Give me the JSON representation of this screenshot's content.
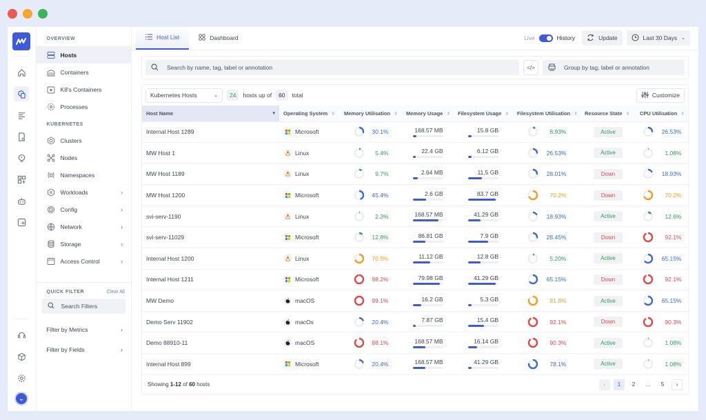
{
  "sidebar": {
    "overview_title": "OVERVIEW",
    "overview_items": [
      {
        "label": "Hosts",
        "icon": "server-icon",
        "active": true
      },
      {
        "label": "Containers",
        "icon": "container-icon"
      },
      {
        "label": "K8's Containers",
        "icon": "k8s-container-icon"
      },
      {
        "label": "Processes",
        "icon": "process-icon"
      }
    ],
    "kubernetes_title": "KUBERNETES",
    "kubernetes_items": [
      {
        "label": "Clusters",
        "icon": "cluster-icon",
        "chevron": false
      },
      {
        "label": "Nodes",
        "icon": "nodes-icon",
        "chevron": false
      },
      {
        "label": "Namespaces",
        "icon": "namespace-icon",
        "chevron": false
      },
      {
        "label": "Workloads",
        "icon": "workloads-icon",
        "chevron": true
      },
      {
        "label": "Config",
        "icon": "config-icon",
        "chevron": true
      },
      {
        "label": "Network",
        "icon": "globe-icon",
        "chevron": true
      },
      {
        "label": "Storage",
        "icon": "database-icon",
        "chevron": true
      },
      {
        "label": "Access Control",
        "icon": "window-icon",
        "chevron": true
      }
    ],
    "quick_filter_title": "QUICK FILTER",
    "clear_all": "Clear All",
    "search_filters_placeholder": "Search Filters",
    "filters": [
      {
        "label": "Filter by Metrics"
      },
      {
        "label": "Filter by Fields"
      }
    ]
  },
  "rail": {
    "icons": [
      "home-icon",
      "infrastructure-icon",
      "logs-icon",
      "report-icon",
      "alert-icon",
      "add-widget-icon",
      "bot-icon",
      "user-report-icon"
    ],
    "bottom_icons": [
      "support-icon",
      "integration-icon",
      "settings-icon"
    ]
  },
  "topbar": {
    "tabs": [
      {
        "label": "Host List",
        "active": true
      },
      {
        "label": "Dashboard",
        "active": false
      }
    ],
    "live_label": "Live",
    "history_label": "History",
    "update_label": "Update",
    "time_range": "Last 30 Days"
  },
  "search": {
    "placeholder": "Search by name, tag, label or annotation",
    "group_placeholder": "Group by tag, label or annotation"
  },
  "toolbar": {
    "host_type": "Kubernetes Hosts",
    "shown_count": "24",
    "count_text_mid": "hosts up of",
    "total_count": "60",
    "count_text_end": "total",
    "customize_label": "Customize"
  },
  "table": {
    "columns": [
      "Host Name",
      "Operating System",
      "Memory Utilisation",
      "Memory Usage",
      "Filesystem Usage",
      "Filesystem Utilisation",
      "Resource State",
      "CPU Utilisation"
    ],
    "rows": [
      {
        "name": "Internal Host 1289",
        "os": "Microsoft",
        "os_icon": "windows-icon",
        "mem_util": "30.1%",
        "mem_util_v": 30.1,
        "mem_util_c": "blue",
        "mem_usage": "168.57 MB",
        "mem_bar": 0.12,
        "fs_usage": "15.8 GB",
        "fs_bar": 0.12,
        "fs_util": "8.93%",
        "fs_util_v": 8.93,
        "fs_util_c": "green",
        "state": "Active",
        "cpu": "26.53%",
        "cpu_v": 26.53,
        "cpu_c": "blue"
      },
      {
        "name": "MW Host 1",
        "os": "Linux",
        "os_icon": "linux-icon",
        "mem_util": "5.4%",
        "mem_util_v": 5.4,
        "mem_util_c": "green",
        "mem_usage": "22.4 GB",
        "mem_bar": 0.1,
        "fs_usage": "6.12 GB",
        "fs_bar": 0.12,
        "fs_util": "26.53%",
        "fs_util_v": 26.53,
        "fs_util_c": "blue",
        "state": "Active",
        "cpu": "1.08%",
        "cpu_v": 1.08,
        "cpu_c": "green"
      },
      {
        "name": "MW Host 1189",
        "os": "Linux",
        "os_icon": "linux-icon",
        "mem_util": "9.7%",
        "mem_util_v": 9.7,
        "mem_util_c": "green",
        "mem_usage": "2.64 MB",
        "mem_bar": 0.18,
        "fs_usage": "11.5 GB",
        "fs_bar": 0.45,
        "fs_util": "28.01%",
        "fs_util_v": 28.01,
        "fs_util_c": "blue",
        "state": "Down",
        "cpu": "18.93%",
        "cpu_v": 18.93,
        "cpu_c": "blue"
      },
      {
        "name": "MW Host 1200",
        "os": "Microsoft",
        "os_icon": "windows-icon",
        "mem_util": "45.4%",
        "mem_util_v": 45.4,
        "mem_util_c": "blue",
        "mem_usage": "2.6 GB",
        "mem_bar": 0.45,
        "fs_usage": "83.7 GB",
        "fs_bar": 0.92,
        "fs_util": "70.2%",
        "fs_util_v": 70.2,
        "fs_util_c": "orange",
        "state": "Down",
        "cpu": "70.2%",
        "cpu_v": 70.2,
        "cpu_c": "orange"
      },
      {
        "name": "svi-serv-1190",
        "os": "Linux",
        "os_icon": "linux-icon",
        "mem_util": "2.3%",
        "mem_util_v": 2.3,
        "mem_util_c": "green",
        "mem_usage": "168.57 MB",
        "mem_bar": 0.85,
        "fs_usage": "41.29 GB",
        "fs_bar": 0.4,
        "fs_util": "18.93%",
        "fs_util_v": 18.93,
        "fs_util_c": "blue",
        "state": "Active",
        "cpu": "12.6%",
        "cpu_v": 12.6,
        "cpu_c": "green"
      },
      {
        "name": "svi-serv-11029",
        "os": "Microsoft",
        "os_icon": "windows-icon",
        "mem_util": "12.8%",
        "mem_util_v": 12.8,
        "mem_util_c": "green",
        "mem_usage": "86.81 GB",
        "mem_bar": 0.42,
        "fs_usage": "7.9 GB",
        "fs_bar": 0.65,
        "fs_util": "28.45%",
        "fs_util_v": 28.45,
        "fs_util_c": "blue",
        "state": "Down",
        "cpu": "92.1%",
        "cpu_v": 92.1,
        "cpu_c": "red"
      },
      {
        "name": "Internal Host 1200",
        "os": "Linux",
        "os_icon": "linux-icon",
        "mem_util": "70.5%",
        "mem_util_v": 70.5,
        "mem_util_c": "orange",
        "mem_usage": "11.12 GB",
        "mem_bar": 0.58,
        "fs_usage": "12.8 GB",
        "fs_bar": 0.4,
        "fs_util": "5.20%",
        "fs_util_v": 5.2,
        "fs_util_c": "green",
        "state": "Active",
        "cpu": "65.15%",
        "cpu_v": 65.15,
        "cpu_c": "blue"
      },
      {
        "name": "Internal Host 1211",
        "os": "Microsoft",
        "os_icon": "windows-icon",
        "mem_util": "98.2%",
        "mem_util_v": 98.2,
        "mem_util_c": "red",
        "mem_usage": "79.98 GB",
        "mem_bar": 0.9,
        "fs_usage": "41.29 GB",
        "fs_bar": 0.92,
        "fs_util": "65.15%",
        "fs_util_v": 65.15,
        "fs_util_c": "blue",
        "state": "Down",
        "cpu": "92.1%",
        "cpu_v": 92.1,
        "cpu_c": "red"
      },
      {
        "name": "MW Demo",
        "os": "macOS",
        "os_icon": "apple-icon",
        "mem_util": "99.1%",
        "mem_util_v": 99.1,
        "mem_util_c": "red",
        "mem_usage": "16.2 GB",
        "mem_bar": 0.28,
        "fs_usage": "5.3 GB",
        "fs_bar": 0.12,
        "fs_util": "81.8%",
        "fs_util_v": 81.8,
        "fs_util_c": "orange",
        "state": "Active",
        "cpu": "65.15%",
        "cpu_v": 65.15,
        "cpu_c": "blue"
      },
      {
        "name": "Demo Serv 11902",
        "os": "macOs",
        "os_icon": "apple-icon",
        "mem_util": "20.4%",
        "mem_util_v": 20.4,
        "mem_util_c": "blue",
        "mem_usage": "7.87 GB",
        "mem_bar": 0.1,
        "fs_usage": "15.4 GB",
        "fs_bar": 0.53,
        "fs_util": "92.1%",
        "fs_util_v": 92.1,
        "fs_util_c": "red",
        "state": "Down",
        "cpu": "90.3%",
        "cpu_v": 90.3,
        "cpu_c": "red"
      },
      {
        "name": "Demo 88910-11",
        "os": "macOS",
        "os_icon": "apple-icon",
        "mem_util": "88.1%",
        "mem_util_v": 88.1,
        "mem_util_c": "red",
        "mem_usage": "168.57 MB",
        "mem_bar": 0.42,
        "fs_usage": "16.14 GB",
        "fs_bar": 0.3,
        "fs_util": "90.3%",
        "fs_util_v": 90.3,
        "fs_util_c": "red",
        "state": "Active",
        "cpu": "1.08%",
        "cpu_v": 1.08,
        "cpu_c": "green"
      },
      {
        "name": "Internal Host 899",
        "os": "Microsoft",
        "os_icon": "windows-icon",
        "mem_util": "20.4%",
        "mem_util_v": 20.4,
        "mem_util_c": "blue",
        "mem_usage": "168.57 MB",
        "mem_bar": 0.42,
        "fs_usage": "41.29 GB",
        "fs_bar": 0.12,
        "fs_util": "78.1%",
        "fs_util_v": 78.1,
        "fs_util_c": "blue",
        "state": "Active",
        "cpu": "1.08%",
        "cpu_v": 1.08,
        "cpu_c": "green"
      }
    ]
  },
  "footer": {
    "showing_prefix": "Showing",
    "showing_range": "1-12",
    "showing_of": "of",
    "showing_total": "60",
    "showing_suffix": "hosts",
    "pages": [
      "1",
      "2",
      "...",
      "5"
    ],
    "current_page": "1"
  },
  "colors": {
    "accent": "#3d5bd9",
    "blue": "#3d6ad9",
    "green": "#2f9e5b",
    "orange": "#f39c22",
    "red": "#e04848"
  }
}
